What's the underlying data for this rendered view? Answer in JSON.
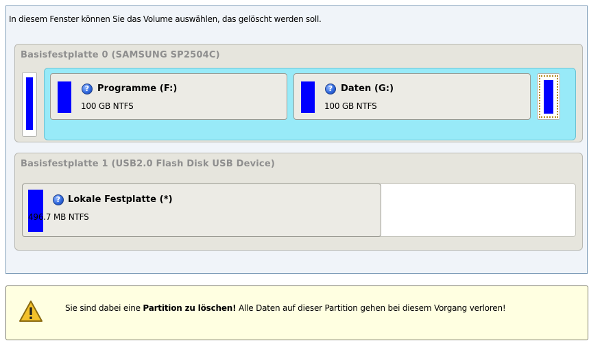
{
  "instruction": "In diesem Fenster können Sie das Volume auswählen, das gelöscht werden soll.",
  "disks": [
    {
      "title": "Basisfestplatte 0 (SAMSUNG SP2504C)",
      "volumes": [
        {
          "name": "Programme (F:)",
          "info": "100 GB NTFS",
          "icon": "help-icon"
        },
        {
          "name": "Daten (G:)",
          "info": "100 GB NTFS",
          "icon": "help-icon"
        }
      ]
    },
    {
      "title": "Basisfestplatte 1 (USB2.0 Flash Disk USB Device)",
      "volumes": [
        {
          "name": "Lokale Festplatte (*)",
          "info": "496.7 MB NTFS",
          "icon": "help-icon"
        }
      ]
    }
  ],
  "warning": {
    "icon": "warning-icon",
    "text_before": "Sie sind dabei eine ",
    "text_bold": "Partition zu löschen!",
    "text_after": " Alle Daten auf dieser Partition gehen bei diesem Vorgang verloren!"
  },
  "colors": {
    "usage_bar": "#0000ff",
    "selected_frame": "#98eaf8",
    "warning_bg": "#ffffe1"
  }
}
